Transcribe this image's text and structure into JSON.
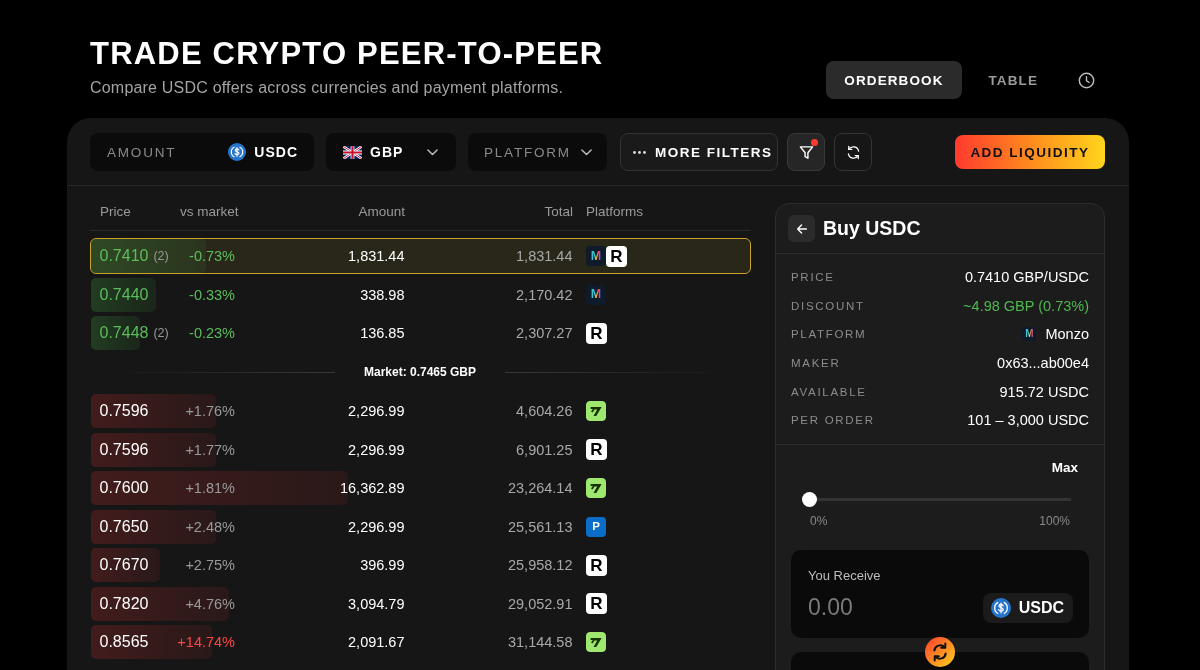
{
  "header": {
    "title": "TRADE CRYPTO PEER-TO-PEER",
    "subtitle": "Compare USDC offers across currencies and payment platforms."
  },
  "view_tabs": [
    {
      "label": "ORDERBOOK",
      "selected": true
    },
    {
      "label": "TABLE",
      "selected": false
    }
  ],
  "toolbar": {
    "amount_field": {
      "placeholder": "AMOUNT",
      "token": "USDC"
    },
    "currency_select": {
      "value": "GBP"
    },
    "platform_select": {
      "placeholder": "PLATFORM"
    },
    "more_filters_button": {
      "label": "MORE FILTERS"
    },
    "filter_button": {
      "active": true
    },
    "add_liquidity_button": {
      "label": "ADD LIQUIDITY"
    }
  },
  "orderbook": {
    "columns": [
      "Price",
      "vs market",
      "Amount",
      "Total",
      "Platforms"
    ],
    "bids": [
      {
        "price": "0.7410",
        "count": "(2)",
        "vs_market": "-0.73%",
        "amount": "1,831.44",
        "total": "1,831.44",
        "platforms": [
          {
            "kind": "monzo",
            "letter": "M"
          },
          {
            "kind": "revolut",
            "letter": "R"
          }
        ],
        "level": 0.175,
        "selected": true
      },
      {
        "price": "0.7440",
        "vs_market": "-0.33%",
        "amount": "338.98",
        "total": "2,170.42",
        "platforms": [
          {
            "kind": "monzo",
            "letter": "M"
          }
        ],
        "level": 0.098,
        "selected": false
      },
      {
        "price": "0.7448",
        "count": "(2)",
        "vs_market": "-0.23%",
        "amount": "136.85",
        "total": "2,307.27",
        "platforms": [
          {
            "kind": "revolut",
            "letter": "R"
          }
        ],
        "level": 0.074,
        "selected": false
      }
    ],
    "market_price": "Market: 0.7465 GBP",
    "asks": [
      {
        "price": "0.7596",
        "vs_market": "+1.76%",
        "amount": "2,296.99",
        "total": "4,604.26",
        "platforms": [
          {
            "kind": "wise"
          }
        ],
        "level": 0.19,
        "selected": false,
        "warning": false
      },
      {
        "price": "0.7596",
        "vs_market": "+1.77%",
        "amount": "2,296.99",
        "total": "6,901.25",
        "platforms": [
          {
            "kind": "revolut",
            "letter": "R"
          }
        ],
        "level": 0.19,
        "selected": false,
        "warning": false
      },
      {
        "price": "0.7600",
        "vs_market": "+1.81%",
        "amount": "16,362.89",
        "total": "23,264.14",
        "platforms": [
          {
            "kind": "wise"
          }
        ],
        "level": 0.39,
        "selected": false,
        "warning": false
      },
      {
        "price": "0.7650",
        "vs_market": "+2.48%",
        "amount": "2,296.99",
        "total": "25,561.13",
        "platforms": [
          {
            "kind": "paypal",
            "letter": "P"
          }
        ],
        "level": 0.19,
        "selected": false,
        "warning": false
      },
      {
        "price": "0.7670",
        "vs_market": "+2.75%",
        "amount": "396.99",
        "total": "25,958.12",
        "platforms": [
          {
            "kind": "revolut",
            "letter": "R"
          }
        ],
        "level": 0.104,
        "selected": false,
        "warning": false
      },
      {
        "price": "0.7820",
        "vs_market": "+4.76%",
        "amount": "3,094.79",
        "total": "29,052.91",
        "platforms": [
          {
            "kind": "revolut",
            "letter": "R"
          }
        ],
        "level": 0.21,
        "selected": false,
        "warning": false
      },
      {
        "price": "0.8565",
        "vs_market": "+14.74%",
        "amount": "2,091.67",
        "total": "31,144.58",
        "platforms": [
          {
            "kind": "wise"
          }
        ],
        "level": 0.183,
        "selected": false,
        "warning": true
      }
    ]
  },
  "offer_panel": {
    "title": "Buy USDC",
    "details": [
      {
        "kind": "plain",
        "label": "PRICE",
        "value": "0.7410 GBP/USDC"
      },
      {
        "kind": "positive",
        "label": "DISCOUNT",
        "value": "~4.98 GBP (0.73%)"
      },
      {
        "kind": "platform",
        "label": "PLATFORM",
        "value": "Monzo",
        "platform": {
          "kind": "monzo",
          "letter": "M"
        }
      },
      {
        "kind": "plain",
        "label": "MAKER",
        "value": "0x63...ab00e4"
      },
      {
        "kind": "plain",
        "label": "AVAILABLE",
        "value": "915.72 USDC"
      },
      {
        "kind": "plain",
        "label": "PER ORDER",
        "value": "101 – 3,000 USDC"
      }
    ],
    "max_button": "Max",
    "slider": {
      "level": 0,
      "min_label": "0%",
      "max_label": "100%"
    },
    "receive": {
      "label": "You Receive",
      "placeholder": "0.00",
      "token": "USDC"
    }
  }
}
